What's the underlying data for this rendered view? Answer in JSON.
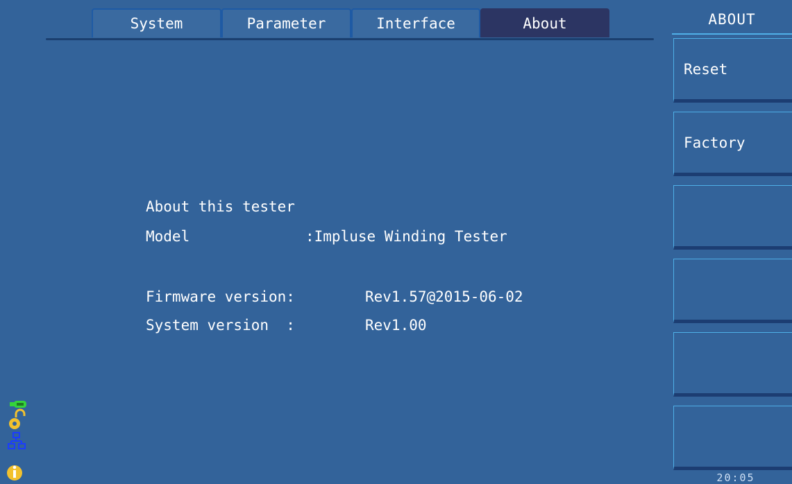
{
  "tabs": [
    {
      "label": "System"
    },
    {
      "label": "Parameter"
    },
    {
      "label": "Interface"
    },
    {
      "label": "About",
      "active": true
    }
  ],
  "sidebar": {
    "title": "ABOUT",
    "buttons": [
      {
        "label": "Reset"
      },
      {
        "label": "Factory"
      },
      {
        "label": ""
      },
      {
        "label": ""
      },
      {
        "label": ""
      },
      {
        "label": ""
      }
    ],
    "clock": "20:05"
  },
  "about": {
    "heading": "About this tester",
    "model_label": "Model",
    "model_value": ":Impluse Winding Tester",
    "firmware_label": "Firmware version:",
    "firmware_value": "Rev1.57@2015-06-02",
    "system_label": "System version  :",
    "system_value": "Rev1.00"
  },
  "status_icons": [
    "usb-icon",
    "lock-icon",
    "network-icon",
    "info-icon"
  ],
  "colors": {
    "background": "#33639a",
    "active_tab": "#2c3563",
    "accent_border": "#4fb0e8"
  }
}
